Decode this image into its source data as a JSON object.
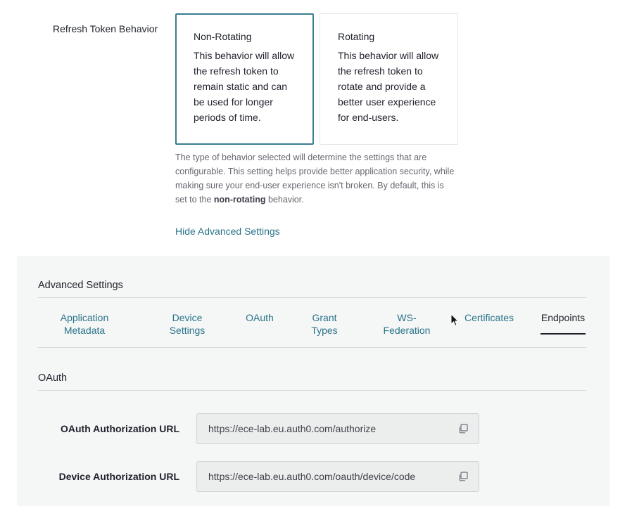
{
  "refresh_token": {
    "label": "Refresh Token Behavior",
    "options": [
      {
        "title": "Non-Rotating",
        "description": "This behavior will allow the refresh token to remain static and can be used for longer periods of time.",
        "selected": true
      },
      {
        "title": "Rotating",
        "description": "This behavior will allow the refresh token to rotate and provide a better user experience for end-users.",
        "selected": false
      }
    ],
    "help_prefix": "The type of behavior selected will determine the settings that are configurable. This setting helps provide better application security, while making sure your end-user experience isn't broken. By default, this is set to the ",
    "help_bold": "non-rotating",
    "help_suffix": " behavior.",
    "toggle_link": "Hide Advanced Settings"
  },
  "advanced": {
    "title": "Advanced Settings",
    "tabs": [
      {
        "label": "Application Metadata",
        "line1": "Application",
        "line2": "Metadata",
        "active": false
      },
      {
        "label": "Device Settings",
        "line1": "Device",
        "line2": "Settings",
        "active": false
      },
      {
        "label": "OAuth",
        "line1": "OAuth",
        "line2": "",
        "active": false
      },
      {
        "label": "Grant Types",
        "line1": "Grant",
        "line2": "Types",
        "active": false
      },
      {
        "label": "WS-Federation",
        "line1": "WS-",
        "line2": "Federation",
        "active": false
      },
      {
        "label": "Certificates",
        "line1": "Certificates",
        "line2": "",
        "active": false
      },
      {
        "label": "Endpoints",
        "line1": "Endpoints",
        "line2": "",
        "active": true
      }
    ],
    "section_title": "OAuth",
    "fields": [
      {
        "label": "OAuth Authorization URL",
        "value": "https://ece-lab.eu.auth0.com/authorize",
        "icon": "copy-icon"
      },
      {
        "label": "Device Authorization URL",
        "value": "https://ece-lab.eu.auth0.com/oauth/device/code",
        "icon": "copy-icon"
      }
    ]
  },
  "colors": {
    "accent": "#29748a",
    "selected_border": "#3a7e8f",
    "panel_bg": "#f5f6f6",
    "text": "#1e212a"
  }
}
